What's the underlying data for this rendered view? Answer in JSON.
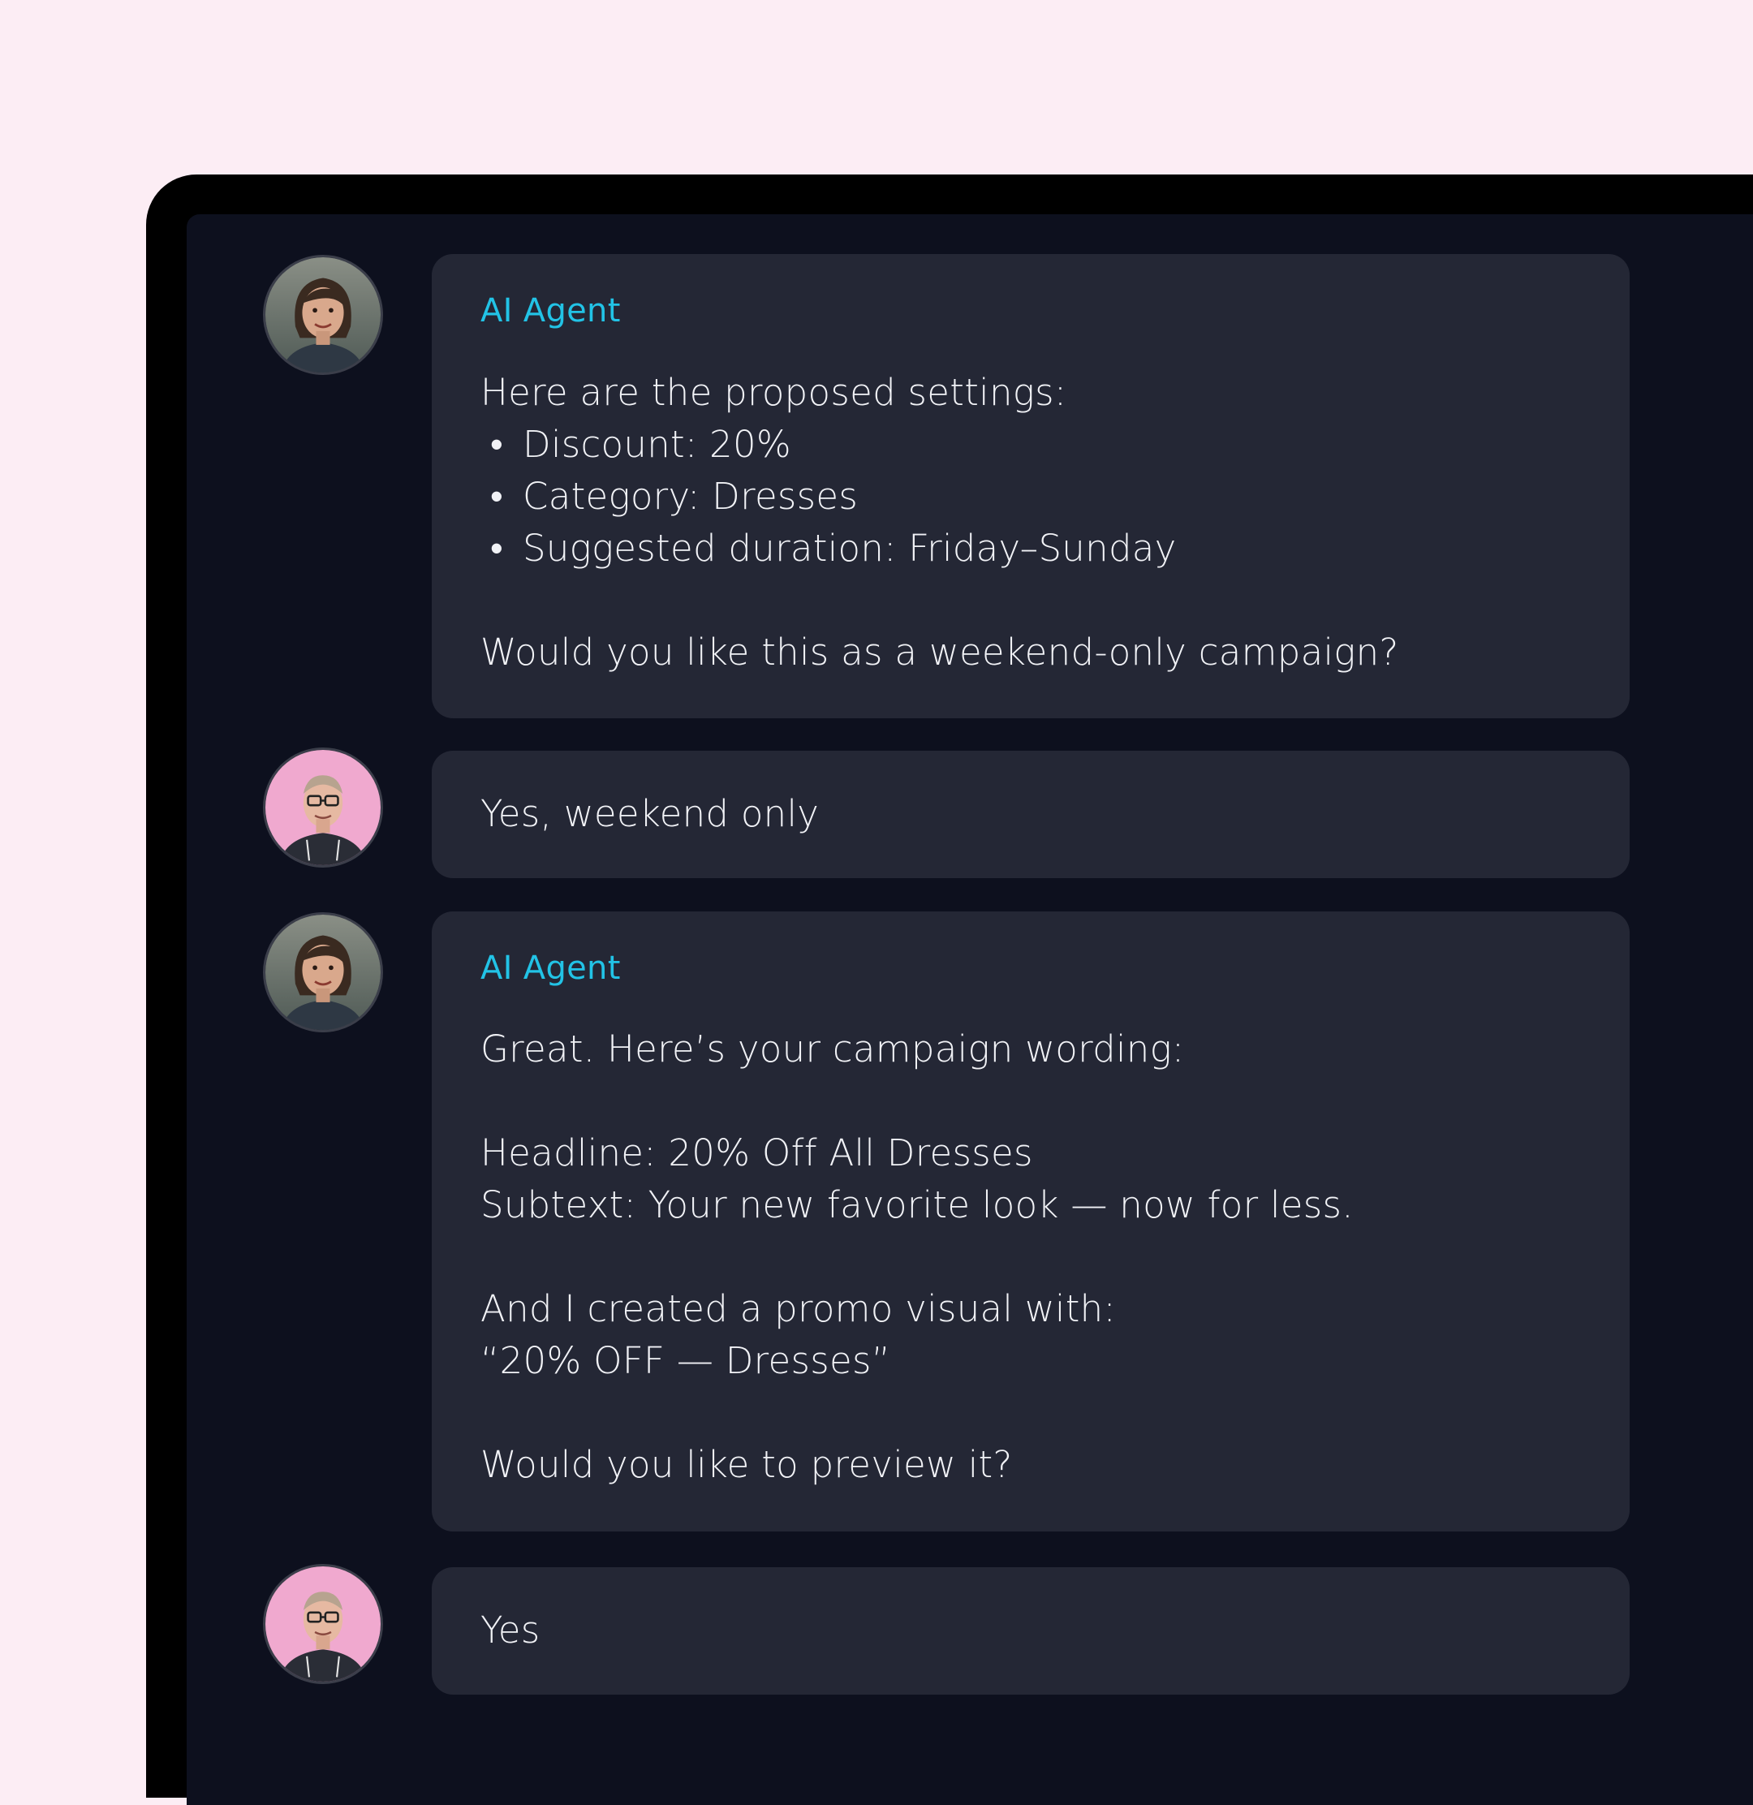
{
  "theme": {
    "page_bg": "#fcedf4",
    "frame_bg": "#000000",
    "screen_bg": "#0d101e",
    "bubble_bg": "#242735",
    "text_color": "#f1f2f6",
    "accent": "#22c3e6"
  },
  "messages": [
    {
      "sender": "AI Agent",
      "avatar": "agent-avatar",
      "intro": "Here are the proposed settings:",
      "bullets": [
        "Discount: 20%",
        "Category: Dresses",
        "Suggested duration: Friday–Sunday"
      ],
      "question": "Would you like this as a weekend-only campaign?"
    },
    {
      "avatar": "user-avatar",
      "text": "Yes, weekend only"
    },
    {
      "sender": "AI Agent",
      "avatar": "agent-avatar",
      "intro": "Great. Here’s your campaign wording:",
      "headline": "Headline: 20% Off All Dresses",
      "subtext": "Subtext: Your new favorite look — now for less.",
      "visual_intro": "And I created a promo visual with:",
      "visual_text": "“20% OFF — Dresses”",
      "question": "Would you like to preview it?"
    },
    {
      "avatar": "user-avatar",
      "text": "Yes"
    }
  ],
  "bullet_glyph": "•"
}
